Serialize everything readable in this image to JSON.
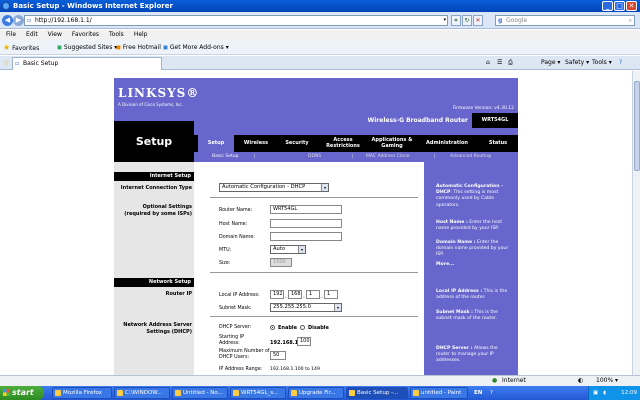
{
  "window": {
    "title": "Basic Setup - Windows Internet Explorer"
  },
  "address_bar": {
    "url": "http://192.168.1.1/",
    "search_placeholder": "Google"
  },
  "menu": [
    "File",
    "Edit",
    "View",
    "Favorites",
    "Tools",
    "Help"
  ],
  "favorites_bar": {
    "favorites_label": "Favorites",
    "items": [
      "Suggested Sites ▾",
      "Free Hotmail",
      "Get More Add-ons ▾"
    ]
  },
  "tab": {
    "label": "Basic Setup"
  },
  "commands": [
    "Page ▾",
    "Safety ▾",
    "Tools ▾"
  ],
  "router": {
    "brand": "LINKSYS®",
    "brand_sub": "A Division of Cisco Systems, Inc.",
    "firmware": "Firmware Version: v4.30.12",
    "section_title": "Setup",
    "product_name": "Wireless-G Broadband Router",
    "model": "WRT54GL",
    "tabs": [
      {
        "label": "Setup"
      },
      {
        "label": "Wireless"
      },
      {
        "label": "Security"
      },
      {
        "label": "Access Restrictions"
      },
      {
        "label": "Applications & Gaming"
      },
      {
        "label": "Administration"
      },
      {
        "label": "Status"
      }
    ],
    "subtabs": [
      "Basic Setup",
      "DDNS",
      "MAC Address Clone",
      "Advanced Routing"
    ],
    "left": {
      "internet_setup": "Internet Setup",
      "connection_type": "Internet Connection Type",
      "optional_settings": "Optional Settings (required by some ISPs)",
      "network_setup": "Network Setup",
      "router_ip": "Router IP",
      "dhcp_settings": "Network Address Server Settings (DHCP)"
    },
    "form": {
      "connection_type_value": "Automatic Configuration - DHCP",
      "router_name_label": "Router Name:",
      "router_name_value": "WRT54GL",
      "host_name_label": "Host Name:",
      "domain_name_label": "Domain Name:",
      "mtu_label": "MTU:",
      "mtu_value": "Auto",
      "size_label": "Size:",
      "size_value": "1500",
      "local_ip_label": "Local IP Address:",
      "ip": [
        "192",
        "168",
        "1",
        "1"
      ],
      "subnet_label": "Subnet Mask:",
      "subnet_value": "255.255.255.0",
      "dhcp_server_label": "DHCP Server:",
      "enable_label": "Enable",
      "disable_label": "Disable",
      "start_ip_label": "Starting IP Address:",
      "start_ip_prefix": "192.168.1.",
      "start_ip_value": "100",
      "max_users_label": "Maximum Number of DHCP Users:",
      "max_users_value": "50",
      "ip_range_label": "IP Address Range:",
      "ip_range_value": "192.168.1.100 to 149"
    },
    "help": {
      "p1_title": "Automatic Configuration - DHCP",
      "p1_body": ": This setting is most commonly used by Cable operators.",
      "p2_title": "Host Name :",
      "p2_body": " Enter the host name provided by your ISP.",
      "p3_title": "Domain Name :",
      "p3_body": " Enter the domain name provided by your ISP.",
      "more": "More...",
      "p4_title": "Local IP Address :",
      "p4_body": " This is the address of the router.",
      "p5_title": "Subnet Mask :",
      "p5_body": " This is the subnet mask of the router.",
      "p6_title": "DHCP Server :",
      "p6_body": " Allows the router to manage your IP addresses."
    }
  },
  "status_bar": {
    "zone": "Internet",
    "zoom": "100% ▾"
  },
  "taskbar": {
    "start": "start",
    "items": [
      {
        "label": "Mozilla Firefox",
        "active": false
      },
      {
        "label": "C:\\WINDOW...",
        "active": false
      },
      {
        "label": "Untitled - No...",
        "active": false
      },
      {
        "label": "WRT54GL_s...",
        "active": false
      },
      {
        "label": "Upgrade Fir...",
        "active": false
      },
      {
        "label": "Basic Setup -...",
        "active": true
      },
      {
        "label": "untitled - Paint",
        "active": false
      }
    ],
    "lang": "EN",
    "clock": "12:09"
  }
}
